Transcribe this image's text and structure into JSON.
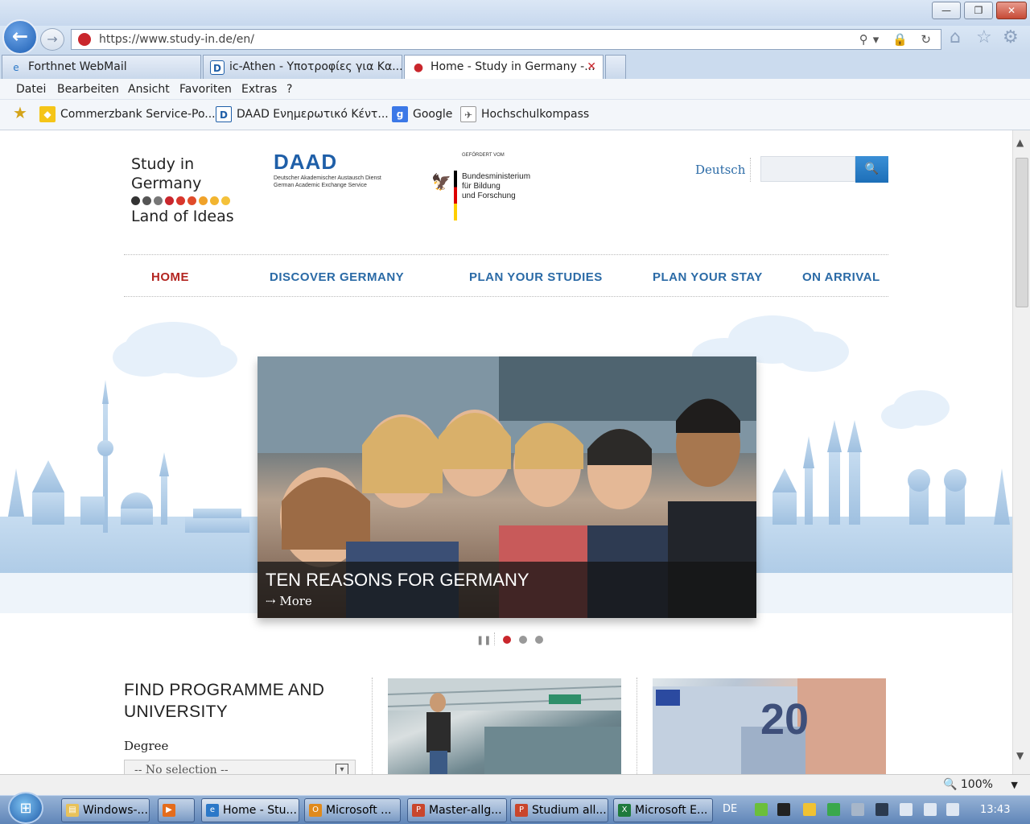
{
  "window": {
    "minimize_label": "—",
    "maximize_label": "❐",
    "close_label": "✕"
  },
  "address": {
    "url": "https://www.study-in.de/en/",
    "icons": "⚲▾ 🔒 ↻"
  },
  "tabs": [
    {
      "label": "Forthnet WebMail",
      "icon": "e"
    },
    {
      "label": "ic-Athen - Υποτροφίες για Κα...",
      "icon": "D"
    },
    {
      "label": "Home - Study in Germany -...",
      "icon": "●",
      "close": "✕"
    }
  ],
  "menu": [
    "Datei",
    "Bearbeiten",
    "Ansicht",
    "Favoriten",
    "Extras",
    "?"
  ],
  "favorites": [
    {
      "label": "Commerzbank Service-Po...",
      "icon": "◆"
    },
    {
      "label": "DAAD Ενημερωτικό Κέντ...",
      "icon": "D"
    },
    {
      "label": "Google",
      "icon": "g"
    },
    {
      "label": "Hochschulkompass",
      "icon": "✈"
    }
  ],
  "site": {
    "logo_line1": "Study in",
    "logo_line2": "Germany",
    "logo_line3": "Land of Ideas",
    "daad_title": "DAAD",
    "daad_sub1": "Deutscher Akademischer Austausch Dienst",
    "daad_sub2": "German Academic Exchange Service",
    "bmbf_gefoerdert": "GEFÖRDERT VOM",
    "bmbf_line1": "Bundesministerium",
    "bmbf_line2": "für Bildung",
    "bmbf_line3": "und Forschung",
    "lang_link": "Deutsch",
    "search_icon": "🔍",
    "nav": [
      "HOME",
      "DISCOVER GERMANY",
      "PLAN YOUR STUDIES",
      "PLAN YOUR STAY",
      "ON ARRIVAL"
    ],
    "hero_title": "TEN REASONS FOR GERMANY",
    "hero_more": "⇢ More",
    "slider_pause": "❚❚",
    "find_title_1": "FIND PROGRAMME AND",
    "find_title_2": "UNIVERSITY",
    "degree_label": "Degree",
    "degree_value": "-- No selection --",
    "degree_chevron": "▾",
    "teaser2_number": "20"
  },
  "status": {
    "zoom": "100%",
    "zoom_arrow": "▼"
  },
  "taskbar": {
    "start_icon": "⊞",
    "buttons": [
      {
        "label": "Windows-...",
        "icon": "▤"
      },
      {
        "label": "",
        "icon": "▶"
      },
      {
        "label": "Home - Stu...",
        "icon": "e"
      },
      {
        "label": "Microsoft ...",
        "icon": "O"
      },
      {
        "label": "Master-allg...",
        "icon": "P"
      },
      {
        "label": "Studium all...",
        "icon": "P"
      },
      {
        "label": "Microsoft E...",
        "icon": "X"
      }
    ],
    "lang": "DE",
    "clock": "13:43"
  },
  "colors": {
    "brand_blue": "#2a6aa6",
    "brand_red": "#b32520",
    "search_blue": "#1d6fb8"
  }
}
